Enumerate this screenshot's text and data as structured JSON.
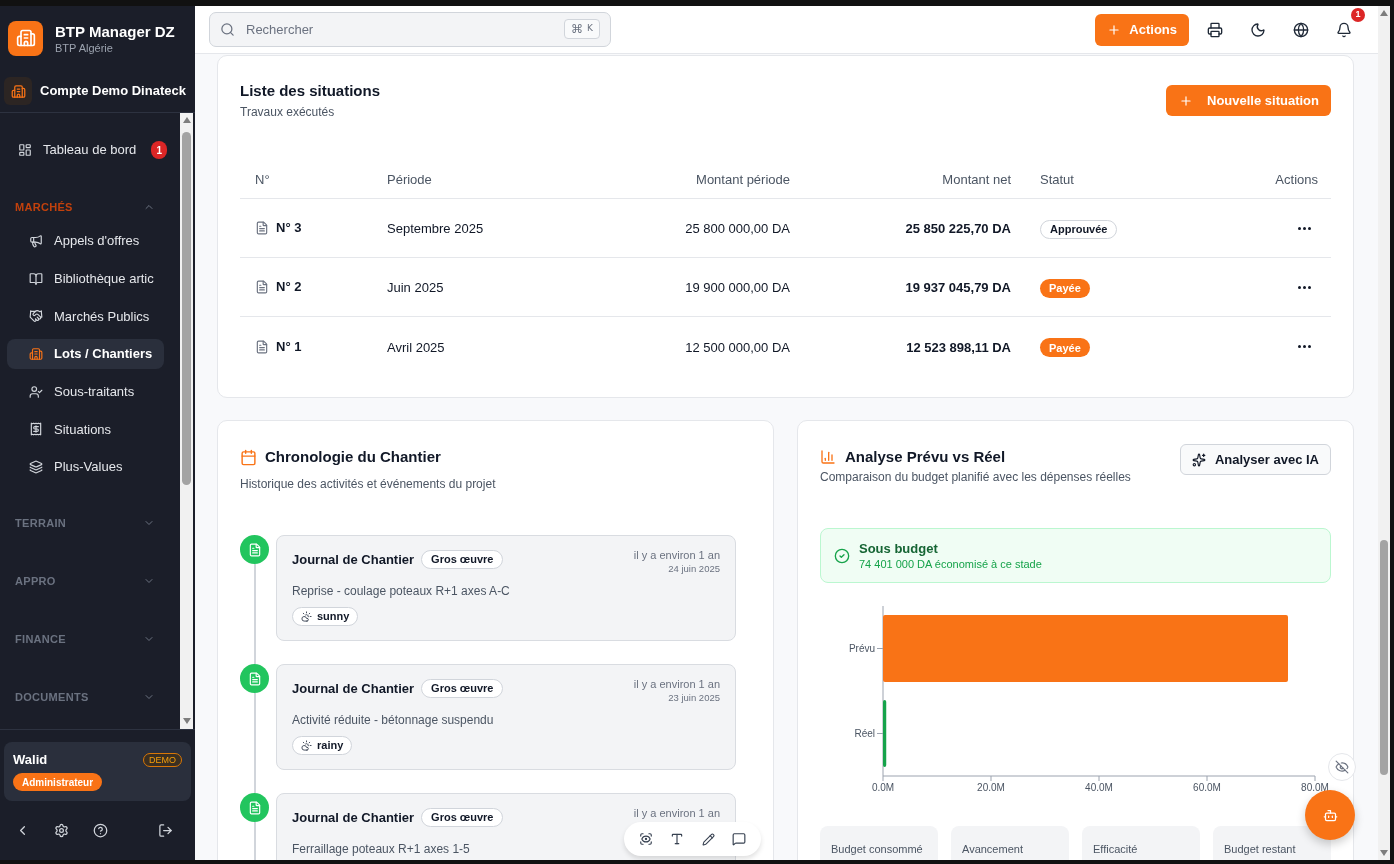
{
  "sidebar": {
    "brand": {
      "name": "BTP Manager DZ",
      "subtitle": "BTP Algérie"
    },
    "account": "Compte Demo Dinateck",
    "nav": [
      {
        "label": "Tableau de bord",
        "badge": "1",
        "selected": false
      }
    ],
    "sections": [
      {
        "title": "MARCHÉS",
        "expanded": true,
        "items": [
          {
            "label": "Appels d'offres",
            "selected": false
          },
          {
            "label": "Bibliothèque artic",
            "selected": false
          },
          {
            "label": "Marchés Publics",
            "selected": false
          },
          {
            "label": "Lots / Chantiers",
            "selected": true
          },
          {
            "label": "Sous-traitants",
            "selected": false
          },
          {
            "label": "Situations",
            "selected": false
          },
          {
            "label": "Plus-Values",
            "selected": false
          }
        ]
      },
      {
        "title": "TERRAIN",
        "expanded": false
      },
      {
        "title": "APPRO",
        "expanded": false
      },
      {
        "title": "FINANCE",
        "expanded": false
      },
      {
        "title": "DOCUMENTS",
        "expanded": false
      }
    ],
    "user": {
      "name": "Walid",
      "badge": "DEMO",
      "role": "Administrateur"
    }
  },
  "header": {
    "search": {
      "placeholder": "Rechercher",
      "shortcut": [
        "⌘",
        "K"
      ]
    },
    "actions_button": "Actions",
    "notification_count": "1"
  },
  "situations": {
    "title": "Liste des situations",
    "subtitle": "Travaux exécutés",
    "new_button": "Nouvelle situation",
    "columns": [
      "N°",
      "Période",
      "Montant période",
      "Montant net",
      "Statut",
      "Actions"
    ],
    "rows": [
      {
        "number": "N° 3",
        "period": "Septembre 2025",
        "amount_period": "25 800 000,00 DA",
        "amount_net": "25 850 225,70 DA",
        "status": {
          "label": "Approuvée",
          "kind": "approved"
        }
      },
      {
        "number": "N° 2",
        "period": "Juin 2025",
        "amount_period": "19 900 000,00 DA",
        "amount_net": "19 937 045,79 DA",
        "status": {
          "label": "Payée",
          "kind": "paid"
        }
      },
      {
        "number": "N° 1",
        "period": "Avril 2025",
        "amount_period": "12 500 000,00 DA",
        "amount_net": "12 523 898,11 DA",
        "status": {
          "label": "Payée",
          "kind": "paid"
        }
      }
    ]
  },
  "timeline": {
    "title": "Chronologie du Chantier",
    "subtitle": "Historique des activités et événements du projet",
    "entries": [
      {
        "title": "Journal de Chantier",
        "tag": "Gros œuvre",
        "relative_time": "il y a environ 1 an",
        "date": "24 juin 2025",
        "description": "Reprise - coulage poteaux R+1 axes A-C",
        "weather": "sunny"
      },
      {
        "title": "Journal de Chantier",
        "tag": "Gros œuvre",
        "relative_time": "il y a environ 1 an",
        "date": "23 juin 2025",
        "description": "Activité réduite - bétonnage suspendu",
        "weather": "rainy"
      },
      {
        "title": "Journal de Chantier",
        "tag": "Gros œuvre",
        "relative_time": "il y a environ 1 an",
        "description": "Ferraillage poteaux R+1 axes 1-5"
      }
    ]
  },
  "analysis": {
    "title": "Analyse Prévu vs Réel",
    "subtitle": "Comparaison du budget planifié avec les dépenses réelles",
    "ai_button": "Analyser avec IA",
    "alert": {
      "kind": "success",
      "title": "Sous budget",
      "message": "74 401 000 DA économisé à ce stade"
    },
    "chart_data": {
      "type": "bar",
      "orientation": "horizontal",
      "stacked": true,
      "categories": [
        "Prévu",
        "Réel"
      ],
      "series": [
        {
          "color": "#f97316",
          "values": [
            75.0,
            0
          ]
        },
        {
          "color": "#16a34a",
          "values": [
            0,
            0.6
          ]
        }
      ],
      "xlim": [
        0,
        80
      ],
      "xticks": [
        {
          "value": 0,
          "label": "0.0M"
        },
        {
          "value": 20,
          "label": "20.0M"
        },
        {
          "value": 40,
          "label": "40.0M"
        },
        {
          "value": 60,
          "label": "60.0M"
        },
        {
          "value": 80,
          "label": "80.0M"
        }
      ]
    },
    "stats": [
      "Budget consommé",
      "Avancement",
      "Efficacité",
      "Budget restant"
    ]
  }
}
